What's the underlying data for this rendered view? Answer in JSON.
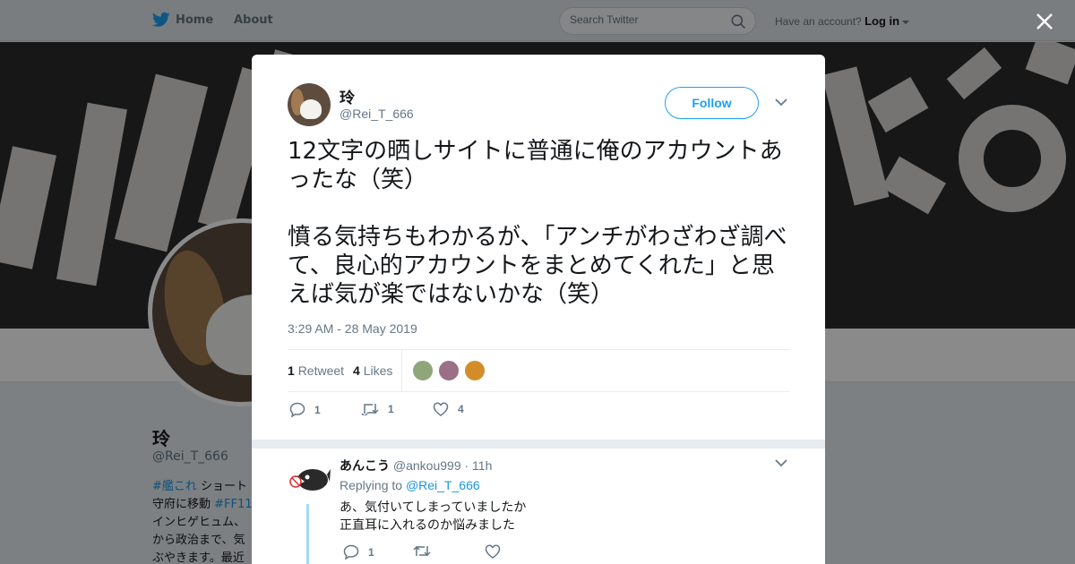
{
  "nav": {
    "home_label": "Home",
    "about_label": "About",
    "search_placeholder": "Search Twitter",
    "account_prompt": "Have an account?",
    "login_label": "Log in"
  },
  "profile": {
    "name": "玲",
    "handle": "@Rei_T_666",
    "bio_tag": "#艦これ",
    "bio_lines": [
      "ショート",
      "守府に移動",
      "インヒゲヒュム、",
      "から政治まで、気",
      "ぶやきます。最近"
    ],
    "bio_tag2": "#FF11"
  },
  "tweet": {
    "author_name": "玲",
    "author_handle": "@Rei_T_666",
    "follow_label": "Follow",
    "text": "12文字の晒しサイトに普通に俺のアカウントあったな（笑）\n\n憤る気持ちもわかるが、「アンチがわざわざ調べて、良心的アカウントをまとめてくれた」と思えば気が楽ではないかな（笑）",
    "timestamp": "3:29 AM - 28 May 2019",
    "retweet_count": "1",
    "retweet_label": "Retweet",
    "like_count": "4",
    "like_label": "Likes",
    "action_reply_count": "1",
    "action_retweet_count": "1",
    "action_like_count": "4"
  },
  "reply": {
    "name": "あんこう",
    "handle": "@ankou999",
    "age": "· 11h",
    "replying_to_label": "Replying to",
    "replying_to_handle": "@Rei_T_666",
    "text": "あ、気付いてしまっていましたか\n正直耳に入れるのか悩みました",
    "reply_count": "1"
  },
  "colors": {
    "accent": "#1da1f2",
    "link": "#1b95e0",
    "overlay": "rgba(0,0,0,0.46)"
  },
  "icons": [
    "twitter-bird-icon",
    "search-icon",
    "close-icon",
    "chevron-down-icon",
    "reply-icon",
    "retweet-icon",
    "heart-icon"
  ]
}
